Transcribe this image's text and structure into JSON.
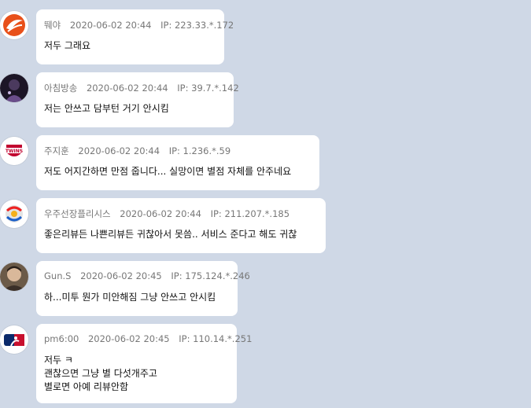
{
  "comments": [
    {
      "nick": "뛔야",
      "time": "2020-06-02 20:44",
      "ip": "IP: 223.33.*.172",
      "text": "저두 그래요",
      "avatar": "orange-swirl-logo-icon"
    },
    {
      "nick": "아침방송",
      "time": "2020-06-02 20:44",
      "ip": "IP: 39.7.*.142",
      "text": "저는 안쓰고 담부턴 거기 안시킴",
      "avatar": "dark-photo-avatar-icon"
    },
    {
      "nick": "주지훈",
      "time": "2020-06-02 20:44",
      "ip": "IP: 1.236.*.59",
      "text": "저도 어지간하면 만점 줍니다... 실망이면 별점 자체를 안주네요",
      "avatar": "twins-logo-icon"
    },
    {
      "nick": "우주선장플리시스",
      "time": "2020-06-02 20:44",
      "ip": "IP: 211.207.*.185",
      "text": "좋은리뷰든 나쁜리뷰든 귀찮아서 못씀.. 서비스 준다고 해도 귀찮",
      "avatar": "colorful-ball-logo-icon"
    },
    {
      "nick": "Gun.S",
      "time": "2020-06-02 20:45",
      "ip": "IP: 175.124.*.246",
      "text": "하...미투 뭔가 미안해짐 그냥 안쓰고 안시킴",
      "avatar": "person-photo-avatar-icon"
    },
    {
      "nick": "pm6:00",
      "time": "2020-06-02 20:45",
      "ip": "IP: 110.14.*.251",
      "text": "저두 ㅋ\n괜찮으면 그냥 별 다섯개주고\n별로면 아예 리뷰안함",
      "avatar": "mlb-logo-icon"
    }
  ]
}
